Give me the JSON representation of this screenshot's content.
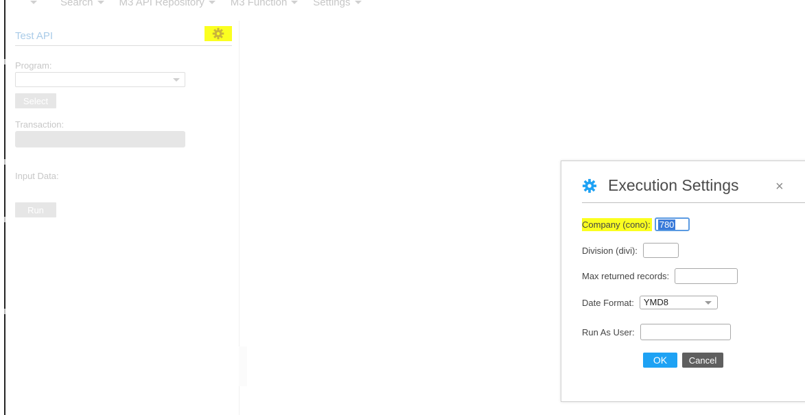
{
  "menubar": {
    "items": [
      {
        "label": ""
      },
      {
        "label": "Search"
      },
      {
        "label": "M3 API Repository"
      },
      {
        "label": "M3 Function"
      },
      {
        "label": "Settings"
      }
    ]
  },
  "test_panel": {
    "title": "Test API",
    "program_label": "Program:",
    "program_value": "",
    "select_button": "Select",
    "transaction_label": "Transaction:",
    "transaction_value": "",
    "input_data_label": "Input Data:",
    "run_button": "Run",
    "highlight_color": "#fbff20"
  },
  "dialog": {
    "title": "Execution Settings",
    "close_symbol": "×",
    "fields": {
      "company_label": "Company (cono):",
      "company_value": "780",
      "division_label": "Division (divi):",
      "division_value": "",
      "max_records_label": "Max returned records:",
      "max_records_value": "",
      "date_format_label": "Date Format:",
      "date_format_value": "YMD8",
      "run_as_user_label": "Run As User:",
      "run_as_user_value": ""
    },
    "ok_button": "OK",
    "cancel_button": "Cancel",
    "colors": {
      "ok": "#1ea2f4",
      "cancel": "#5f5f5f",
      "gear": "#1ea2f4"
    }
  }
}
